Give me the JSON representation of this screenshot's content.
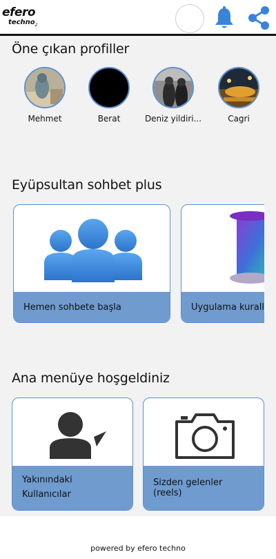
{
  "header": {
    "logo_main": "efero",
    "logo_sub": "techno",
    "logo_sup": "2",
    "icons": [
      "avatar-placeholder",
      "bell-icon",
      "share-icon"
    ]
  },
  "featured": {
    "title": "Öne çıkan profiller",
    "profiles": [
      {
        "name": "Mehmet"
      },
      {
        "name": "Berat"
      },
      {
        "name": "Deniz yildiri..."
      },
      {
        "name": "Cagri"
      }
    ]
  },
  "chat": {
    "title": "Eyüpsultan sohbet plus",
    "cards": [
      {
        "label": "Hemen sohbete başla",
        "icon": "group-users-icon"
      },
      {
        "label": "Uygulama kurall",
        "icon": "scroll-icon"
      }
    ]
  },
  "menu": {
    "title": "Ana menüye hoşgeldiniz",
    "cards": [
      {
        "label": "Yakınındaki Kullanıcılar",
        "icon": "user-location-icon"
      },
      {
        "label": "Sizden gelenler (reels)",
        "icon": "camera-icon"
      }
    ]
  },
  "footer": {
    "text": "powered by efero techno"
  },
  "colors": {
    "accent_blue": "#6f9bcf",
    "border_blue": "#5b8fd0",
    "icon_blue": "#3a84d8"
  }
}
